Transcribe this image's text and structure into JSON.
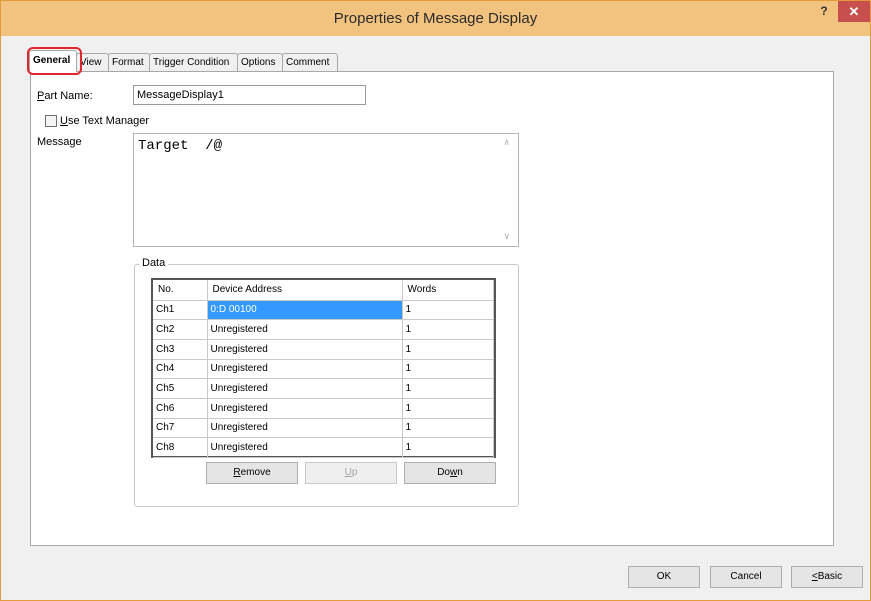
{
  "window": {
    "title": "Properties of Message Display",
    "help_label": "?",
    "close_label": "✕"
  },
  "tabs": [
    {
      "label": "General",
      "active": true
    },
    {
      "label": "View"
    },
    {
      "label": "Format"
    },
    {
      "label": "Trigger Condition"
    },
    {
      "label": "Options"
    },
    {
      "label": "Comment"
    }
  ],
  "general": {
    "part_name_label_accel": "P",
    "part_name_label_rest": "art Name:",
    "part_name_value": "MessageDisplay1",
    "use_text_manager_accel": "U",
    "use_text_manager_rest": "se Text Manager",
    "use_text_manager_checked": false,
    "message_label_pre": "Messa",
    "message_label_accel": "g",
    "message_label_post": "e",
    "message_text": "Target  /@"
  },
  "data_group": {
    "label": "Data",
    "columns": [
      "No.",
      "Device Address",
      "Words"
    ],
    "rows": [
      [
        "Ch1",
        "0:D 00100",
        "1"
      ],
      [
        "Ch2",
        "Unregistered",
        "1"
      ],
      [
        "Ch3",
        "Unregistered",
        "1"
      ],
      [
        "Ch4",
        "Unregistered",
        "1"
      ],
      [
        "Ch5",
        "Unregistered",
        "1"
      ],
      [
        "Ch6",
        "Unregistered",
        "1"
      ],
      [
        "Ch7",
        "Unregistered",
        "1"
      ],
      [
        "Ch8",
        "Unregistered",
        "1"
      ]
    ],
    "remove_accel": "R",
    "remove_rest": "emove",
    "up_accel": "U",
    "up_rest": "p",
    "down_pre": "Do",
    "down_accel": "w",
    "down_post": "n"
  },
  "footer": {
    "ok_label": "OK",
    "cancel_label": "Cancel",
    "basic_accel": "<",
    "basic_rest": "Basic"
  },
  "colors": {
    "titlebar": "#f2c27f",
    "close": "#c7504f",
    "selection": "#3399ff",
    "highlight_ring": "#e0262b"
  }
}
